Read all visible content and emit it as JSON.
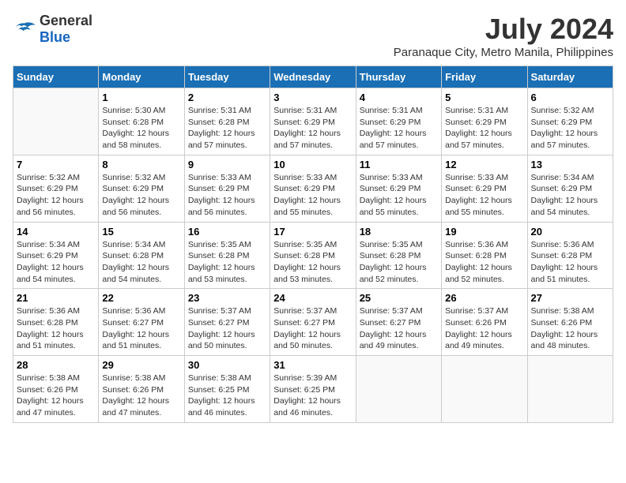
{
  "logo": {
    "general": "General",
    "blue": "Blue"
  },
  "title": {
    "month_year": "July 2024",
    "location": "Paranaque City, Metro Manila, Philippines"
  },
  "days_of_week": [
    "Sunday",
    "Monday",
    "Tuesday",
    "Wednesday",
    "Thursday",
    "Friday",
    "Saturday"
  ],
  "weeks": [
    [
      {
        "day": "",
        "info": ""
      },
      {
        "day": "1",
        "info": "Sunrise: 5:30 AM\nSunset: 6:28 PM\nDaylight: 12 hours\nand 58 minutes."
      },
      {
        "day": "2",
        "info": "Sunrise: 5:31 AM\nSunset: 6:28 PM\nDaylight: 12 hours\nand 57 minutes."
      },
      {
        "day": "3",
        "info": "Sunrise: 5:31 AM\nSunset: 6:29 PM\nDaylight: 12 hours\nand 57 minutes."
      },
      {
        "day": "4",
        "info": "Sunrise: 5:31 AM\nSunset: 6:29 PM\nDaylight: 12 hours\nand 57 minutes."
      },
      {
        "day": "5",
        "info": "Sunrise: 5:31 AM\nSunset: 6:29 PM\nDaylight: 12 hours\nand 57 minutes."
      },
      {
        "day": "6",
        "info": "Sunrise: 5:32 AM\nSunset: 6:29 PM\nDaylight: 12 hours\nand 57 minutes."
      }
    ],
    [
      {
        "day": "7",
        "info": "Sunrise: 5:32 AM\nSunset: 6:29 PM\nDaylight: 12 hours\nand 56 minutes."
      },
      {
        "day": "8",
        "info": "Sunrise: 5:32 AM\nSunset: 6:29 PM\nDaylight: 12 hours\nand 56 minutes."
      },
      {
        "day": "9",
        "info": "Sunrise: 5:33 AM\nSunset: 6:29 PM\nDaylight: 12 hours\nand 56 minutes."
      },
      {
        "day": "10",
        "info": "Sunrise: 5:33 AM\nSunset: 6:29 PM\nDaylight: 12 hours\nand 55 minutes."
      },
      {
        "day": "11",
        "info": "Sunrise: 5:33 AM\nSunset: 6:29 PM\nDaylight: 12 hours\nand 55 minutes."
      },
      {
        "day": "12",
        "info": "Sunrise: 5:33 AM\nSunset: 6:29 PM\nDaylight: 12 hours\nand 55 minutes."
      },
      {
        "day": "13",
        "info": "Sunrise: 5:34 AM\nSunset: 6:29 PM\nDaylight: 12 hours\nand 54 minutes."
      }
    ],
    [
      {
        "day": "14",
        "info": "Sunrise: 5:34 AM\nSunset: 6:29 PM\nDaylight: 12 hours\nand 54 minutes."
      },
      {
        "day": "15",
        "info": "Sunrise: 5:34 AM\nSunset: 6:28 PM\nDaylight: 12 hours\nand 54 minutes."
      },
      {
        "day": "16",
        "info": "Sunrise: 5:35 AM\nSunset: 6:28 PM\nDaylight: 12 hours\nand 53 minutes."
      },
      {
        "day": "17",
        "info": "Sunrise: 5:35 AM\nSunset: 6:28 PM\nDaylight: 12 hours\nand 53 minutes."
      },
      {
        "day": "18",
        "info": "Sunrise: 5:35 AM\nSunset: 6:28 PM\nDaylight: 12 hours\nand 52 minutes."
      },
      {
        "day": "19",
        "info": "Sunrise: 5:36 AM\nSunset: 6:28 PM\nDaylight: 12 hours\nand 52 minutes."
      },
      {
        "day": "20",
        "info": "Sunrise: 5:36 AM\nSunset: 6:28 PM\nDaylight: 12 hours\nand 51 minutes."
      }
    ],
    [
      {
        "day": "21",
        "info": "Sunrise: 5:36 AM\nSunset: 6:28 PM\nDaylight: 12 hours\nand 51 minutes."
      },
      {
        "day": "22",
        "info": "Sunrise: 5:36 AM\nSunset: 6:27 PM\nDaylight: 12 hours\nand 51 minutes."
      },
      {
        "day": "23",
        "info": "Sunrise: 5:37 AM\nSunset: 6:27 PM\nDaylight: 12 hours\nand 50 minutes."
      },
      {
        "day": "24",
        "info": "Sunrise: 5:37 AM\nSunset: 6:27 PM\nDaylight: 12 hours\nand 50 minutes."
      },
      {
        "day": "25",
        "info": "Sunrise: 5:37 AM\nSunset: 6:27 PM\nDaylight: 12 hours\nand 49 minutes."
      },
      {
        "day": "26",
        "info": "Sunrise: 5:37 AM\nSunset: 6:26 PM\nDaylight: 12 hours\nand 49 minutes."
      },
      {
        "day": "27",
        "info": "Sunrise: 5:38 AM\nSunset: 6:26 PM\nDaylight: 12 hours\nand 48 minutes."
      }
    ],
    [
      {
        "day": "28",
        "info": "Sunrise: 5:38 AM\nSunset: 6:26 PM\nDaylight: 12 hours\nand 47 minutes."
      },
      {
        "day": "29",
        "info": "Sunrise: 5:38 AM\nSunset: 6:26 PM\nDaylight: 12 hours\nand 47 minutes."
      },
      {
        "day": "30",
        "info": "Sunrise: 5:38 AM\nSunset: 6:25 PM\nDaylight: 12 hours\nand 46 minutes."
      },
      {
        "day": "31",
        "info": "Sunrise: 5:39 AM\nSunset: 6:25 PM\nDaylight: 12 hours\nand 46 minutes."
      },
      {
        "day": "",
        "info": ""
      },
      {
        "day": "",
        "info": ""
      },
      {
        "day": "",
        "info": ""
      }
    ]
  ]
}
